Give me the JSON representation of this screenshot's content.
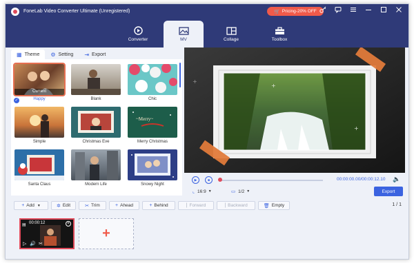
{
  "titlebar": {
    "title": "FoneLab Video Converter Ultimate (Unregistered)",
    "pricing": "Pricing-20% OFF"
  },
  "nav": {
    "tabs": [
      {
        "label": "Converter"
      },
      {
        "label": "MV"
      },
      {
        "label": "Collage"
      },
      {
        "label": "Toolbox"
      }
    ]
  },
  "subtabs": [
    {
      "label": "Theme"
    },
    {
      "label": "Setting"
    },
    {
      "label": "Export"
    }
  ],
  "themes": [
    {
      "label": "Happy",
      "tag": "Current"
    },
    {
      "label": "Blank"
    },
    {
      "label": "Chic"
    },
    {
      "label": "Simple"
    },
    {
      "label": "Christmas Eve"
    },
    {
      "label": "Merry Christmas"
    },
    {
      "label": "Santa Claus"
    },
    {
      "label": "Modern Life"
    },
    {
      "label": "Snowy Night"
    }
  ],
  "player": {
    "timecode": "00:00:00.00/00:00:12.10",
    "aspect": "16:9",
    "resolution": "1/2",
    "export_label": "Export",
    "progress": 0
  },
  "toolbar": {
    "add": "Add",
    "edit": "Edit",
    "trim": "Trim",
    "ahead": "Ahead",
    "behind": "Behind",
    "forward": "Forward",
    "backward": "Backward",
    "empty": "Empty",
    "page": "1",
    "page_total": "1"
  },
  "timeline": {
    "clip_time": "00:00:12"
  },
  "colors": {
    "brand": "#2f3a78",
    "accent": "#3b63e0",
    "promo": "#f05a4a"
  }
}
